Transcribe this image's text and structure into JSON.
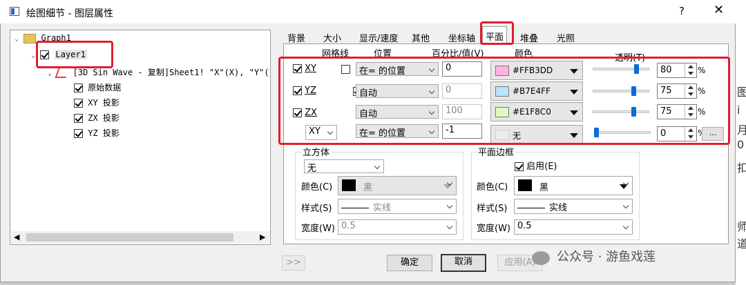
{
  "window": {
    "title": "绘图细节 - 图层属性",
    "help": "?",
    "close": "✕",
    "icon": "window-icon"
  },
  "tree": {
    "graph": "Graph1",
    "layer": "Layer1",
    "plot": "[3D Sin Wave - 复制]Sheet1! \"X\"(X), \"Y\"(",
    "children": [
      "原始数据",
      "XY 投影",
      "ZX 投影",
      "YZ 投影"
    ]
  },
  "tabs": [
    "背景",
    "大小",
    "显示/速度",
    "其他",
    "坐标轴",
    "平面",
    "堆叠",
    "光照"
  ],
  "active_tab": "平面",
  "headers": {
    "grid": "网格线",
    "position": "位置",
    "percent": "百分比/值(V)",
    "color": "颜色",
    "transparency": "透明(T)"
  },
  "planes": [
    {
      "label": "XY",
      "enabled": true,
      "grid": false,
      "position": "在= 的位置",
      "value": "0",
      "color_name": "#FFB3DD",
      "color": "#FFB3DD",
      "transparency": "80",
      "transparency_level": 80
    },
    {
      "label": "YZ",
      "enabled": true,
      "grid": true,
      "position": "自动",
      "value": "0",
      "color_name": "#B7E4FF",
      "color": "#B7E4FF",
      "transparency": "75",
      "transparency_level": 75
    },
    {
      "label": "ZX",
      "enabled": true,
      "grid": true,
      "position": "自动",
      "value": "100",
      "color_name": "#E1F8C0",
      "color": "#E1F8C0",
      "transparency": "75",
      "transparency_level": 75
    },
    {
      "label": "XY",
      "enabled": true,
      "grid": true,
      "position": "在= 的位置",
      "value": "-1",
      "color_name": "无",
      "color": "#ececec",
      "transparency": "0",
      "transparency_level": 0
    }
  ],
  "percent_sign": "%",
  "more_button": "...",
  "cube": {
    "title": "立方体",
    "value": "无",
    "color_label": "颜色(C)",
    "color_value": "黑",
    "style_label": "样式(S)",
    "style_value": "实线",
    "width_label": "宽度(W)",
    "width_value": "0.5"
  },
  "frame": {
    "title": "平面边框",
    "enable_label": "启用(E)",
    "enabled": true,
    "color_label": "颜色(C)",
    "color_value": "黑",
    "style_label": "样式(S)",
    "style_value": "实线",
    "width_label": "宽度(W)",
    "width_value": "0.5"
  },
  "footer": {
    "expand": ">>",
    "ok": "确定",
    "cancel": "取消",
    "apply": "应用(A)"
  },
  "watermark": "公众号 · 游鱼戏莲",
  "accent": "#e21d2b"
}
